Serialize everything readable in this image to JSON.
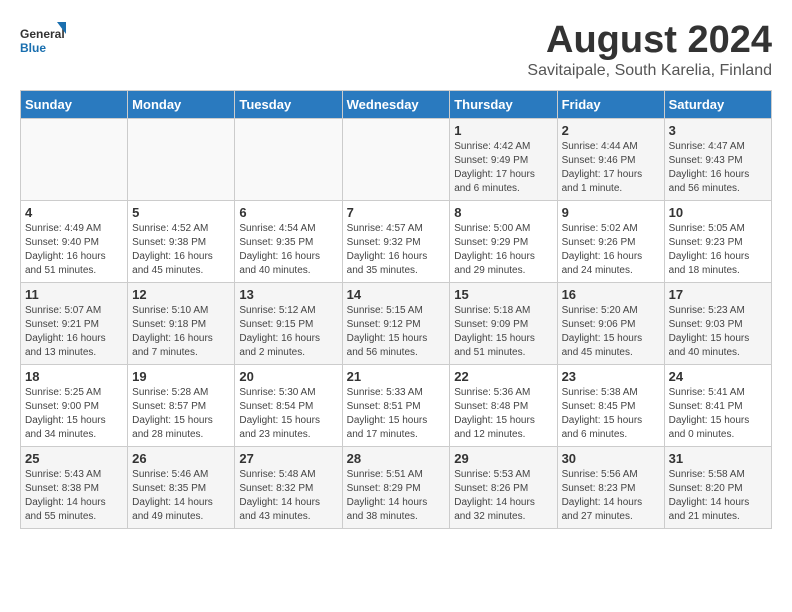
{
  "logo": {
    "general": "General",
    "blue": "Blue"
  },
  "title": "August 2024",
  "subtitle": "Savitaipale, South Karelia, Finland",
  "weekdays": [
    "Sunday",
    "Monday",
    "Tuesday",
    "Wednesday",
    "Thursday",
    "Friday",
    "Saturday"
  ],
  "weeks": [
    [
      {
        "day": "",
        "info": ""
      },
      {
        "day": "",
        "info": ""
      },
      {
        "day": "",
        "info": ""
      },
      {
        "day": "",
        "info": ""
      },
      {
        "day": "1",
        "info": "Sunrise: 4:42 AM\nSunset: 9:49 PM\nDaylight: 17 hours\nand 6 minutes."
      },
      {
        "day": "2",
        "info": "Sunrise: 4:44 AM\nSunset: 9:46 PM\nDaylight: 17 hours\nand 1 minute."
      },
      {
        "day": "3",
        "info": "Sunrise: 4:47 AM\nSunset: 9:43 PM\nDaylight: 16 hours\nand 56 minutes."
      }
    ],
    [
      {
        "day": "4",
        "info": "Sunrise: 4:49 AM\nSunset: 9:40 PM\nDaylight: 16 hours\nand 51 minutes."
      },
      {
        "day": "5",
        "info": "Sunrise: 4:52 AM\nSunset: 9:38 PM\nDaylight: 16 hours\nand 45 minutes."
      },
      {
        "day": "6",
        "info": "Sunrise: 4:54 AM\nSunset: 9:35 PM\nDaylight: 16 hours\nand 40 minutes."
      },
      {
        "day": "7",
        "info": "Sunrise: 4:57 AM\nSunset: 9:32 PM\nDaylight: 16 hours\nand 35 minutes."
      },
      {
        "day": "8",
        "info": "Sunrise: 5:00 AM\nSunset: 9:29 PM\nDaylight: 16 hours\nand 29 minutes."
      },
      {
        "day": "9",
        "info": "Sunrise: 5:02 AM\nSunset: 9:26 PM\nDaylight: 16 hours\nand 24 minutes."
      },
      {
        "day": "10",
        "info": "Sunrise: 5:05 AM\nSunset: 9:23 PM\nDaylight: 16 hours\nand 18 minutes."
      }
    ],
    [
      {
        "day": "11",
        "info": "Sunrise: 5:07 AM\nSunset: 9:21 PM\nDaylight: 16 hours\nand 13 minutes."
      },
      {
        "day": "12",
        "info": "Sunrise: 5:10 AM\nSunset: 9:18 PM\nDaylight: 16 hours\nand 7 minutes."
      },
      {
        "day": "13",
        "info": "Sunrise: 5:12 AM\nSunset: 9:15 PM\nDaylight: 16 hours\nand 2 minutes."
      },
      {
        "day": "14",
        "info": "Sunrise: 5:15 AM\nSunset: 9:12 PM\nDaylight: 15 hours\nand 56 minutes."
      },
      {
        "day": "15",
        "info": "Sunrise: 5:18 AM\nSunset: 9:09 PM\nDaylight: 15 hours\nand 51 minutes."
      },
      {
        "day": "16",
        "info": "Sunrise: 5:20 AM\nSunset: 9:06 PM\nDaylight: 15 hours\nand 45 minutes."
      },
      {
        "day": "17",
        "info": "Sunrise: 5:23 AM\nSunset: 9:03 PM\nDaylight: 15 hours\nand 40 minutes."
      }
    ],
    [
      {
        "day": "18",
        "info": "Sunrise: 5:25 AM\nSunset: 9:00 PM\nDaylight: 15 hours\nand 34 minutes."
      },
      {
        "day": "19",
        "info": "Sunrise: 5:28 AM\nSunset: 8:57 PM\nDaylight: 15 hours\nand 28 minutes."
      },
      {
        "day": "20",
        "info": "Sunrise: 5:30 AM\nSunset: 8:54 PM\nDaylight: 15 hours\nand 23 minutes."
      },
      {
        "day": "21",
        "info": "Sunrise: 5:33 AM\nSunset: 8:51 PM\nDaylight: 15 hours\nand 17 minutes."
      },
      {
        "day": "22",
        "info": "Sunrise: 5:36 AM\nSunset: 8:48 PM\nDaylight: 15 hours\nand 12 minutes."
      },
      {
        "day": "23",
        "info": "Sunrise: 5:38 AM\nSunset: 8:45 PM\nDaylight: 15 hours\nand 6 minutes."
      },
      {
        "day": "24",
        "info": "Sunrise: 5:41 AM\nSunset: 8:41 PM\nDaylight: 15 hours\nand 0 minutes."
      }
    ],
    [
      {
        "day": "25",
        "info": "Sunrise: 5:43 AM\nSunset: 8:38 PM\nDaylight: 14 hours\nand 55 minutes."
      },
      {
        "day": "26",
        "info": "Sunrise: 5:46 AM\nSunset: 8:35 PM\nDaylight: 14 hours\nand 49 minutes."
      },
      {
        "day": "27",
        "info": "Sunrise: 5:48 AM\nSunset: 8:32 PM\nDaylight: 14 hours\nand 43 minutes."
      },
      {
        "day": "28",
        "info": "Sunrise: 5:51 AM\nSunset: 8:29 PM\nDaylight: 14 hours\nand 38 minutes."
      },
      {
        "day": "29",
        "info": "Sunrise: 5:53 AM\nSunset: 8:26 PM\nDaylight: 14 hours\nand 32 minutes."
      },
      {
        "day": "30",
        "info": "Sunrise: 5:56 AM\nSunset: 8:23 PM\nDaylight: 14 hours\nand 27 minutes."
      },
      {
        "day": "31",
        "info": "Sunrise: 5:58 AM\nSunset: 8:20 PM\nDaylight: 14 hours\nand 21 minutes."
      }
    ]
  ]
}
